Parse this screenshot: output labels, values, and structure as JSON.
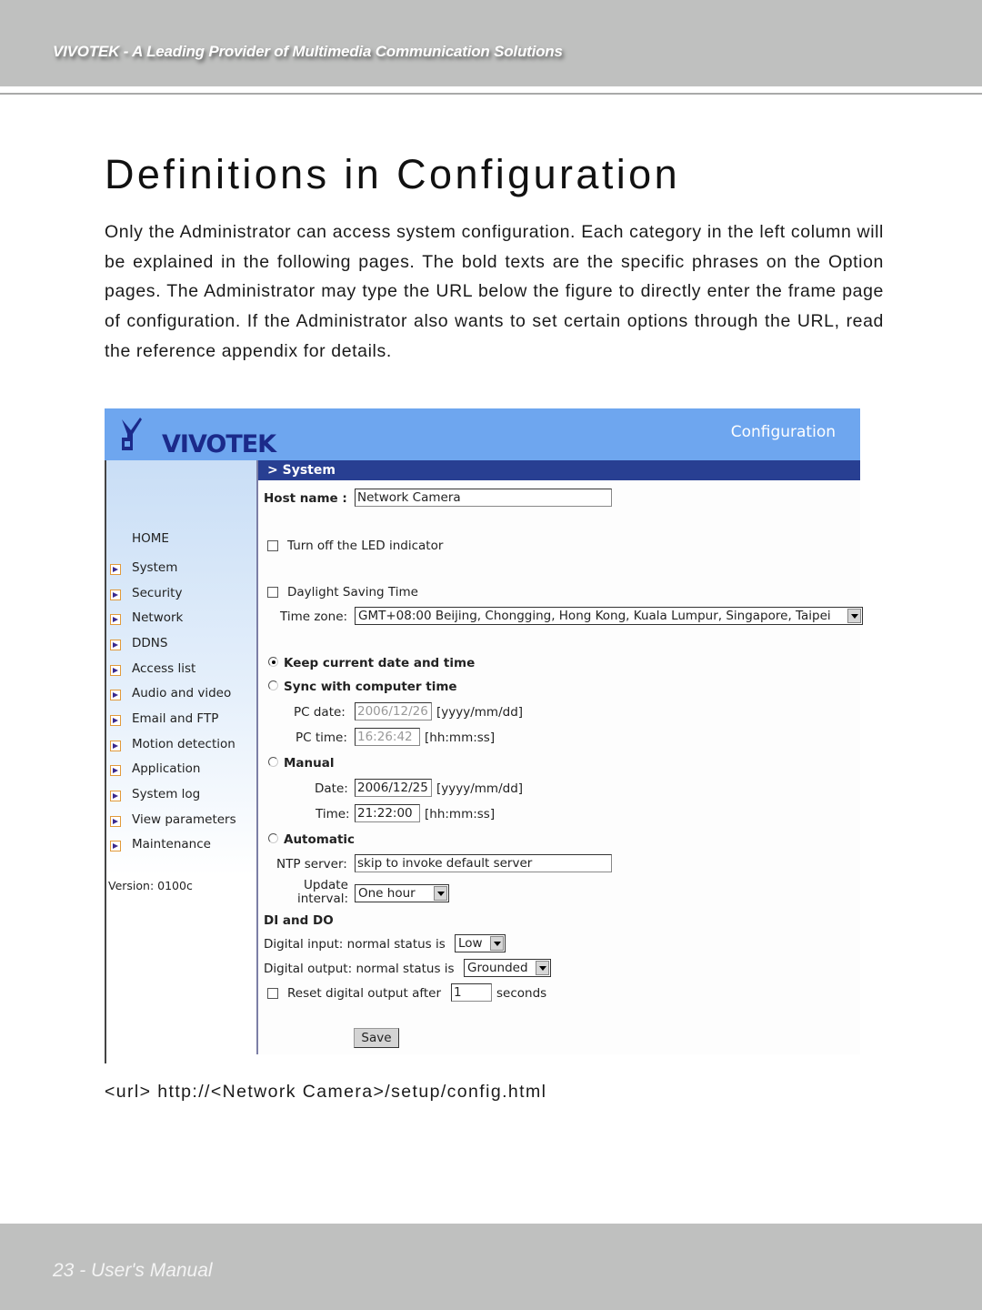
{
  "header": {
    "tagline": "VIVOTEK - A Leading Provider of Multimedia Communication Solutions"
  },
  "page": {
    "title": "Definitions in Configuration",
    "intro": "Only the Administrator can access system configuration. Each category in the left column will be explained in the following pages. The bold texts are the specific phrases on the Option pages. The Administrator may type the URL below the figure to directly enter the frame page of configuration. If the Administrator also wants to set certain options through the URL, read the reference appendix for details.",
    "url_line": "<url> http://<Network Camera>/setup/config.html"
  },
  "figure": {
    "logo_text": "VIVOTEK",
    "header_title": "Configuration",
    "colors": {
      "header": "#6ea6ef",
      "section_bar": "#283f92"
    },
    "sidebar": {
      "home": "HOME",
      "items": [
        {
          "label": "System",
          "icon": "arrow-right-icon"
        },
        {
          "label": "Security",
          "icon": "arrow-right-icon"
        },
        {
          "label": "Network",
          "icon": "arrow-right-icon"
        },
        {
          "label": "DDNS",
          "icon": "arrow-right-icon"
        },
        {
          "label": "Access list",
          "icon": "arrow-right-icon"
        },
        {
          "label": "Audio and video",
          "icon": "arrow-right-icon"
        },
        {
          "label": "Email and FTP",
          "icon": "arrow-right-icon"
        },
        {
          "label": "Motion detection",
          "icon": "arrow-right-icon"
        },
        {
          "label": "Application",
          "icon": "arrow-right-icon"
        },
        {
          "label": "System log",
          "icon": "arrow-right-icon"
        },
        {
          "label": "View parameters",
          "icon": "arrow-right-icon"
        },
        {
          "label": "Maintenance",
          "icon": "arrow-right-icon"
        }
      ],
      "version": "Version: 0100c"
    },
    "form": {
      "section_title": "> System",
      "host_name_label": "Host name :",
      "host_name_value": "Network Camera",
      "led_label": "Turn off the LED indicator",
      "led_checked": false,
      "dst_label": "Daylight Saving Time",
      "dst_checked": false,
      "timezone_label": "Time zone:",
      "timezone_value": "GMT+08:00 Beijing, Chongging, Hong Kong, Kuala Lumpur, Singapore, Taipei",
      "keep_label": "Keep current date and time",
      "keep_selected": true,
      "sync_label": "Sync with computer time",
      "pc_date_label": "PC date:",
      "pc_date_value": "2006/12/26",
      "pc_date_format": "[yyyy/mm/dd]",
      "pc_time_label": "PC time:",
      "pc_time_value": "16:26:42",
      "pc_time_format": "[hh:mm:ss]",
      "manual_label": "Manual",
      "date_label": "Date:",
      "date_value": "2006/12/25",
      "date_format": "[yyyy/mm/dd]",
      "time_label": "Time:",
      "time_value": "21:22:00",
      "time_format": "[hh:mm:ss]",
      "auto_label": "Automatic",
      "ntp_label": "NTP server:",
      "ntp_value": "skip to invoke default server",
      "update_label_1": "Update",
      "update_label_2": "interval:",
      "update_value": "One hour",
      "dido_title": "DI and DO",
      "di_label": "Digital input: normal status is",
      "di_value": "Low",
      "do_label": "Digital output: normal status is",
      "do_value": "Grounded",
      "reset_label": "Reset digital output after",
      "reset_value": "1",
      "reset_unit": "seconds",
      "reset_checked": false,
      "save_label": "Save"
    }
  },
  "footer": {
    "page_label": "23 - User's Manual"
  }
}
